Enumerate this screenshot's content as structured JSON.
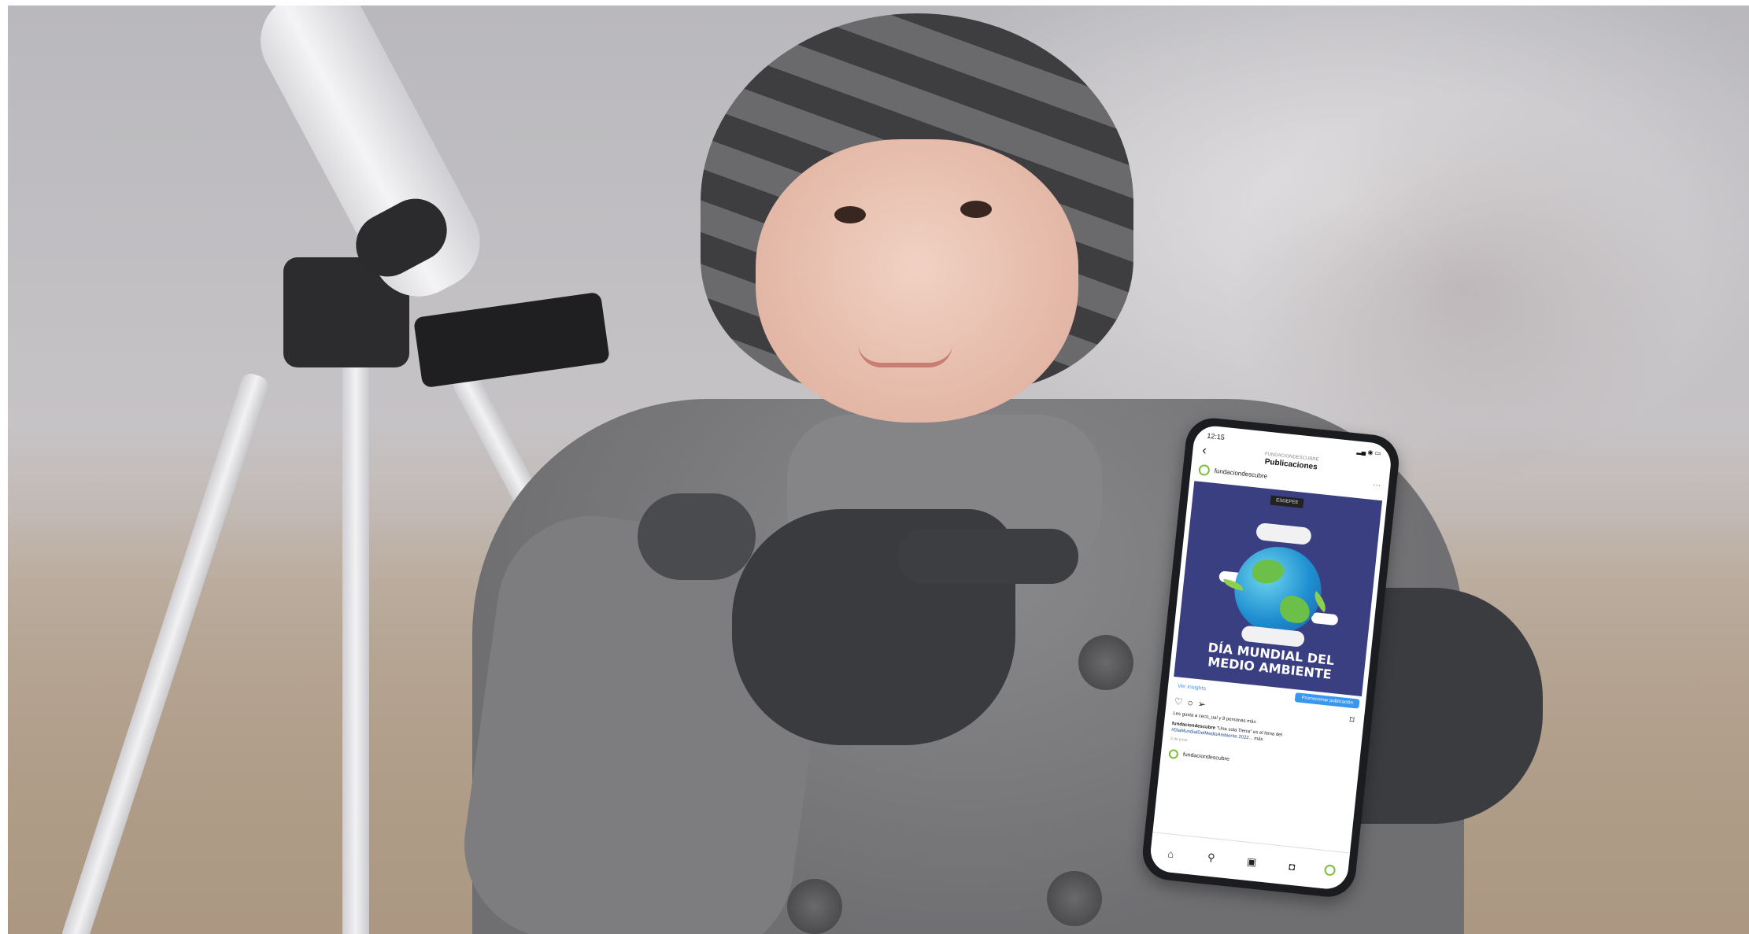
{
  "phone": {
    "status_time": "12:15",
    "header_account": "FUNDACIONDESCUBRE",
    "header_title": "Publicaciones",
    "post": {
      "username": "fundaciondescubre",
      "logo_text": "ESDEPEE",
      "heading_line1": "DÍA MUNDIAL DEL",
      "heading_line2": "MEDIO AMBIENTE",
      "insights_link": "Ver insights",
      "promote_button": "Promocionar publicación",
      "likes_text": "Les gusta a ceco_ual y 8 personas más",
      "caption_user": "fundaciondescubre",
      "caption_text": "\"Una sola Tierra\" es el lema del",
      "caption_hashtag": "#DiaMundialDelMedioAmbiente 2022...",
      "caption_more": "más",
      "date": "5 de junio"
    },
    "next_post_user": "fundaciondescubre",
    "icons": {
      "back": "back-arrow-icon",
      "more": "more-icon",
      "like": "heart-icon",
      "comment": "comment-icon",
      "share": "send-icon",
      "save": "bookmark-icon",
      "home": "home-icon",
      "search": "search-icon",
      "reels": "reels-icon",
      "shop": "shop-icon",
      "profile": "profile-avatar-icon"
    },
    "colors": {
      "post_background": "#3a3f82",
      "accent_blue": "#3897f0",
      "brand_green": "#7bbf3a"
    }
  }
}
